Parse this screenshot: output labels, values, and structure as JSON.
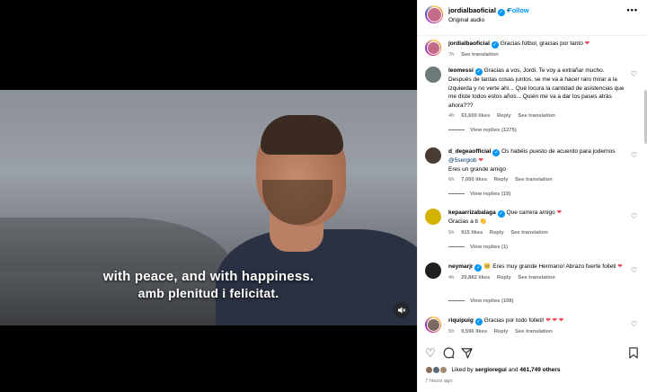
{
  "video": {
    "subtitle_line1": "with peace, and with happiness.",
    "subtitle_line2": "amb plenitud i felicitat.",
    "mute_icon": "speaker-muted-icon"
  },
  "header": {
    "username": "jordialbaoficial",
    "follow_label": "Follow",
    "audio_label": "Original audio",
    "separator": "•",
    "more_label": "•••"
  },
  "caption": {
    "username": "jordialbaoficial",
    "text": "Gracias fútbol, gracias por tanto",
    "emoji": "❤",
    "time": "7h",
    "see_translation": "See translation"
  },
  "comments": [
    {
      "username": "leomessi",
      "text": "Gracias a vos, Jordi. Te voy a extrañar mucho. Después de tantas cosas juntos, se me va a hacer raro mirar a la izquierda y no verte ahí... Qué locura la cantidad de asistencias que me diste todos estos años... Quién me va a dar los pases atrás ahora???",
      "time": "4h",
      "likes": "63,600 likes",
      "reply": "Reply",
      "see_translation": "See translation",
      "view_replies": "View replies (1275)"
    },
    {
      "username": "d_degeaofficial",
      "text": "Os habéis puesto de acuerdo para jodernos",
      "mention": "@5sergiob",
      "emoji": "❤",
      "text2": "Eres un grande amigo",
      "time": "6h",
      "likes": "7,000 likes",
      "reply": "Reply",
      "see_translation": "See translation",
      "view_replies": "View replies (19)"
    },
    {
      "username": "kepaarrizabalaga",
      "text": "Que carrera amigo",
      "emoji": "❤",
      "text2": "Gracias a ti",
      "emoji2": "👏",
      "time": "5h",
      "likes": "915 likes",
      "reply": "Reply",
      "see_translation": "See translation",
      "view_replies": "View replies (1)"
    },
    {
      "username": "neymarjr",
      "emoji_pre": "🥺",
      "text": "Eres muy grande Hermano! Abrazo fuerte folleti",
      "emoji": "❤",
      "time": "4h",
      "likes": "29,882 likes",
      "reply": "Reply",
      "see_translation": "See translation",
      "view_replies": "View replies (108)"
    },
    {
      "username": "riquipuig",
      "text": "Gracias por todo folleti!",
      "emoji": "❤ ❤ ❤",
      "time": "5h",
      "likes": "9,596 likes",
      "reply": "Reply",
      "see_translation": "See translation"
    }
  ],
  "actions": {
    "like_icon": "heart-icon",
    "comment_icon": "comment-icon",
    "share_icon": "share-icon",
    "save_icon": "bookmark-icon",
    "like_glyph": "♡",
    "comment_glyph": "◯",
    "share_glyph": "➤",
    "save_glyph": "⌂"
  },
  "likes_summary": {
    "prefix": "Liked by",
    "user": "sergioregui",
    "and": "and",
    "others": "461,749 others"
  },
  "time_ago": "7 hours ago",
  "colors": {
    "accent": "#0095f6",
    "heart": "#ed4956",
    "muted": "#737373"
  }
}
